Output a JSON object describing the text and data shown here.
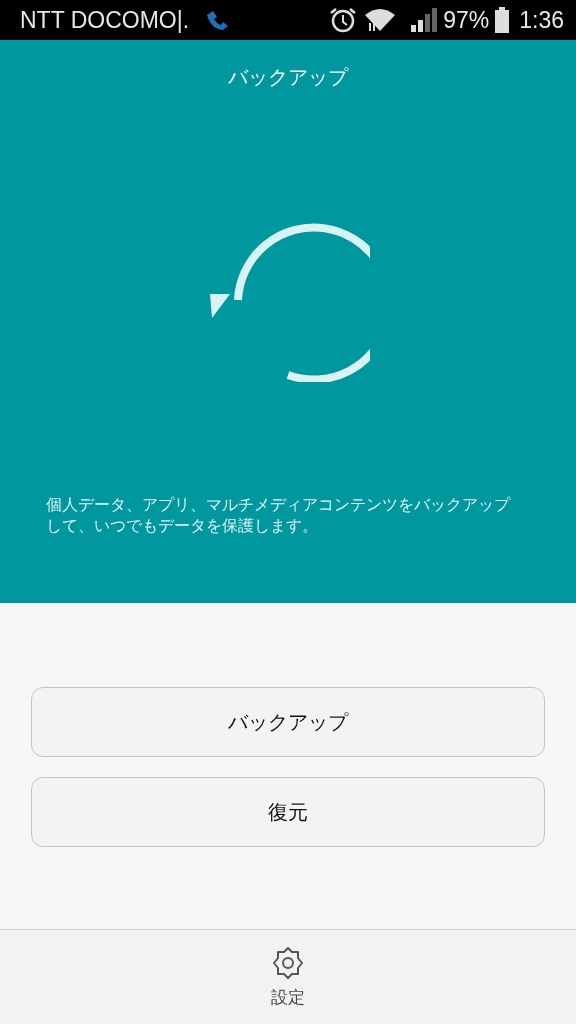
{
  "status_bar": {
    "carrier": "NTT DOCOMO|.",
    "battery": "97%",
    "time": "1:36"
  },
  "header": {
    "title": "バックアップ",
    "description": "個人データ、アプリ、マルチメディアコンテンツをバックアップして、いつでもデータを保護します。"
  },
  "buttons": [
    {
      "label": "バックアップ"
    },
    {
      "label": "復元"
    }
  ],
  "bottom_bar": {
    "label": "設定"
  }
}
